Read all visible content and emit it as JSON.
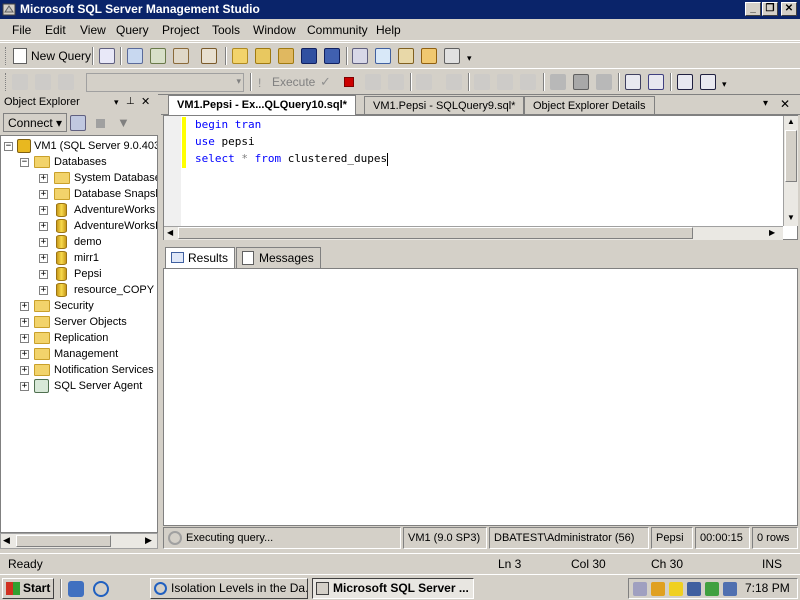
{
  "window": {
    "title": "Microsoft SQL Server Management Studio"
  },
  "menu": [
    "File",
    "Edit",
    "View",
    "Query",
    "Project",
    "Tools",
    "Window",
    "Community",
    "Help"
  ],
  "toolbar1": {
    "new_query_label": "New Query"
  },
  "toolbar2": {
    "execute_label": "Execute",
    "database_select_value": ""
  },
  "object_explorer": {
    "title": "Object Explorer",
    "connect_label": "Connect ▾",
    "server_node": "VM1 (SQL Server 9.0.403",
    "databases_label": "Databases",
    "databases": [
      "System Databases",
      "Database Snapshots",
      "AdventureWorks",
      "AdventureWorksDW",
      "demo",
      "mirr1",
      "Pepsi",
      "resource_COPY"
    ],
    "server_nodes": [
      "Security",
      "Server Objects",
      "Replication",
      "Management",
      "Notification Services",
      "SQL Server Agent"
    ]
  },
  "doc_tabs": [
    "VM1.Pepsi - Ex...QLQuery10.sql*",
    "VM1.Pepsi - SQLQuery9.sql*",
    "Object Explorer Details"
  ],
  "editor": {
    "line1": {
      "kw": "begin tran"
    },
    "line2": {
      "kw": "use",
      "rest": " pepsi"
    },
    "line3": {
      "kw1": "select",
      "star": " * ",
      "kw2": "from",
      "rest": " clustered_dupes"
    }
  },
  "results_tabs": [
    "Results",
    "Messages"
  ],
  "query_status": {
    "message": "Executing query...",
    "server": "VM1 (9.0 SP3)",
    "user": "DBATEST\\Administrator (56)",
    "database": "Pepsi",
    "elapsed": "00:00:15",
    "rows": "0 rows"
  },
  "status_bar": {
    "state": "Ready",
    "line": "Ln 3",
    "col": "Col 30",
    "ch": "Ch 30",
    "mode": "INS"
  },
  "taskbar": {
    "start_label": "Start",
    "tasks": [
      "Isolation Levels in the Da...",
      "Microsoft SQL Server ..."
    ],
    "clock": "7:18 PM"
  },
  "colors": {
    "titlebar": "#0a246a",
    "keyword": "#0000ff",
    "change_bar": "#ffff00"
  }
}
